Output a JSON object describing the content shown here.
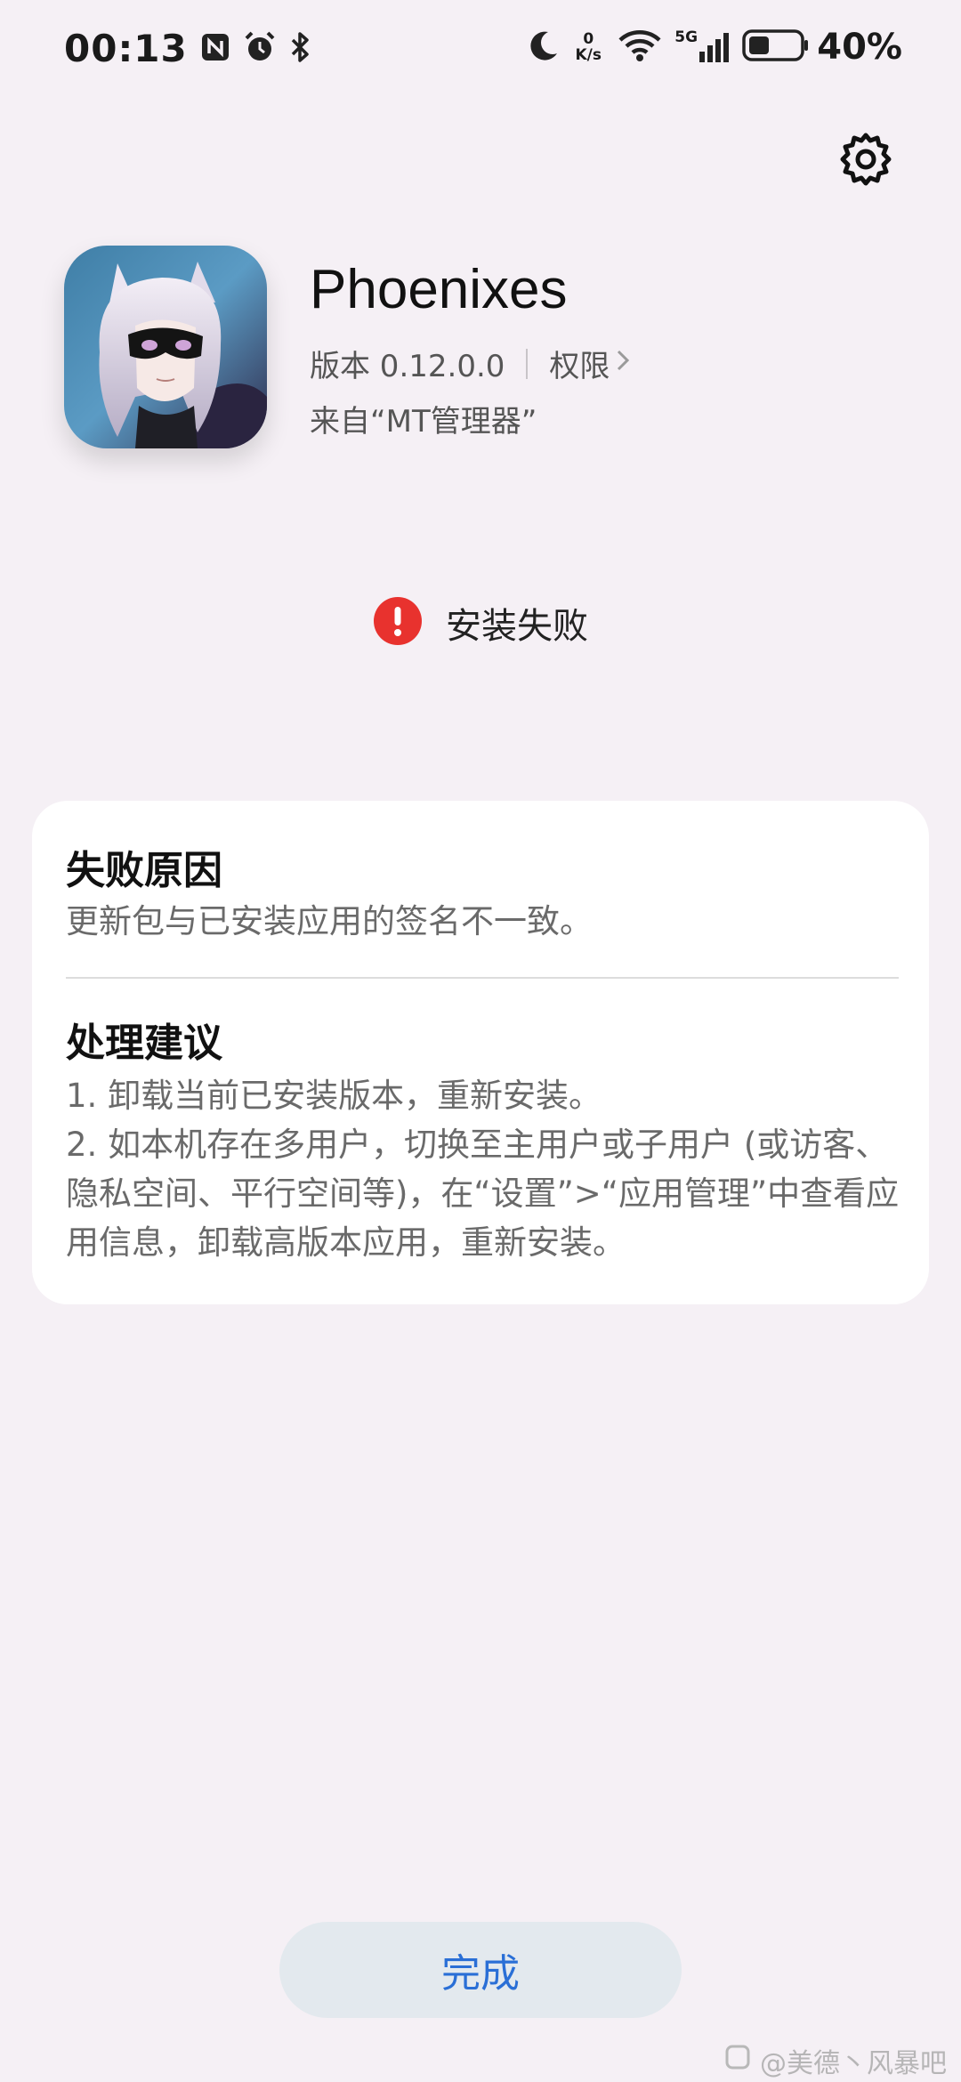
{
  "status_bar": {
    "time": "00:13",
    "net_speed_value": "0",
    "net_speed_unit": "K/s",
    "network_type": "5G",
    "battery_percent": "40%",
    "battery_level": 0.4,
    "icons": [
      "nfc-icon",
      "alarm-icon",
      "bluetooth-icon",
      "moon-icon",
      "wifi-icon",
      "signal-icon",
      "battery-icon"
    ]
  },
  "app": {
    "name": "Phoenixes",
    "version": "版本 0.12.0.0",
    "permissions_label": "权限",
    "source": "来自“MT管理器”"
  },
  "status": {
    "text": "安装失败",
    "icon": "error-icon",
    "color": "#e8322e"
  },
  "failure": {
    "heading": "失败原因",
    "reason": "更新包与已安装应用的签名不一致。"
  },
  "suggestion": {
    "heading": "处理建议",
    "items": [
      "1. 卸载当前已安装版本，重新安装。",
      "2. 如本机存在多用户，切换至主用户或子用户 (或访客、隐私空间、平行空间等)，在“设置”>“应用管理”中查看应用信息，卸载高版本应用，重新安装。"
    ]
  },
  "actions": {
    "done_label": "完成",
    "accent": "#2a6fd6"
  },
  "watermark": {
    "text": "@美德丶风暴吧"
  }
}
